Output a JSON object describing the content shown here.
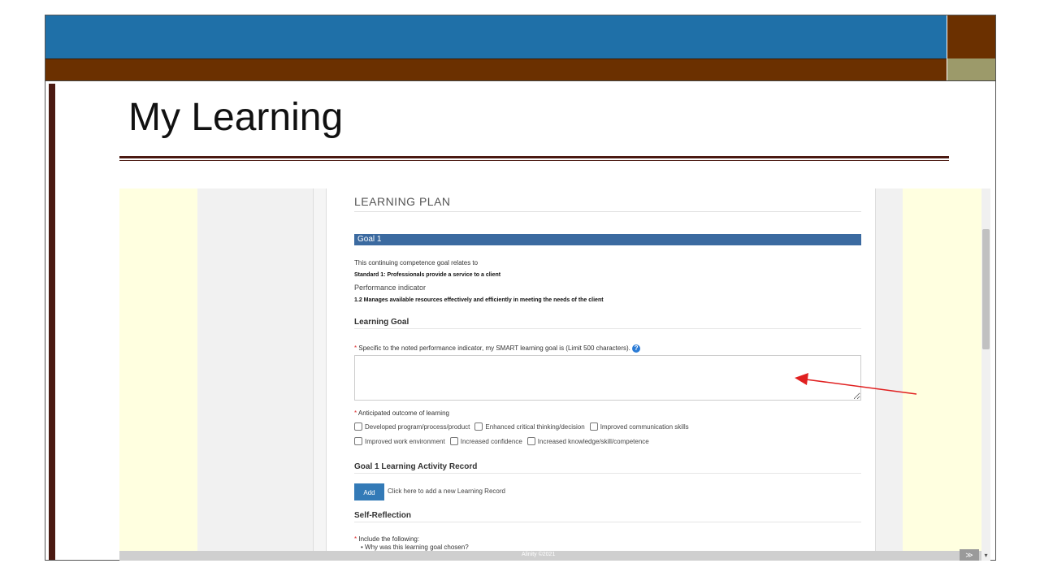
{
  "slide": {
    "title": "My Learning"
  },
  "learning_plan": {
    "heading": "LEARNING PLAN",
    "goal_header": "Goal 1",
    "relates_text": "This continuing competence goal relates to",
    "standard": "Standard 1: Professionals provide a service to a client",
    "perf_indicator_label": "Performance indicator",
    "perf_indicator": "1.2 Manages available resources effectively and efficiently in meeting the needs of the client",
    "learning_goal_heading": "Learning Goal",
    "smart_goal_label": "Specific to the noted performance indicator, my SMART learning goal is (Limit 500 characters).",
    "help_icon": "?",
    "required_mark": "*",
    "outcome_label": "Anticipated outcome of learning",
    "outcomes_row1": [
      "Developed program/process/product",
      "Enhanced critical thinking/decision",
      "Improved communication skills"
    ],
    "outcomes_row2": [
      "Improved work environment",
      "Increased confidence",
      "Increased knowledge/skill/competence"
    ],
    "activity_heading": "Goal 1 Learning Activity Record",
    "add_button": "Add",
    "add_text": "Click here to add a new Learning Record",
    "reflection_heading": "Self-Reflection",
    "include_label": "Include the following:",
    "bullet1": "Why was this learning goal chosen?"
  },
  "footer": {
    "brand": "Alinity ©2021",
    "top_button": "≫"
  },
  "colors": {
    "blue_band": "#1f70a8",
    "brown_band": "#6b3000",
    "goal_bar": "#3b6aa0",
    "add_button": "#337ab7",
    "annotation_arrow": "#e02020"
  }
}
